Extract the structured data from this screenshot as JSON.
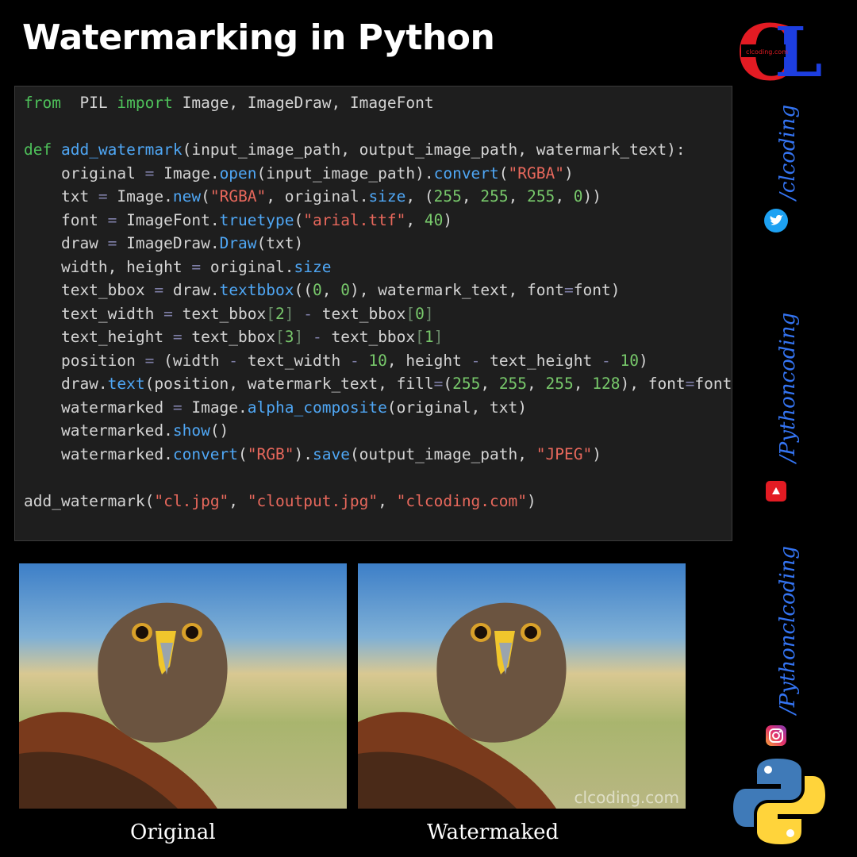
{
  "header": {
    "title": "Watermarking in Python"
  },
  "logo": {
    "letters": "CL",
    "tagline": "clcoding.com"
  },
  "code_lines": [
    [
      [
        "k",
        "from"
      ],
      [
        "",
        "  PIL "
      ],
      [
        "k",
        "import"
      ],
      [
        "",
        " Image, ImageDraw, ImageFont"
      ]
    ],
    [],
    [
      [
        "k",
        "def"
      ],
      [
        "",
        " "
      ],
      [
        "f",
        "add_watermark"
      ],
      [
        "",
        "(input_image_path, output_image_path, watermark_text):"
      ]
    ],
    [
      [
        "",
        "    original "
      ],
      [
        "o",
        "="
      ],
      [
        "",
        " Image."
      ],
      [
        "f",
        "open"
      ],
      [
        "",
        "(input_image_path)."
      ],
      [
        "f",
        "convert"
      ],
      [
        "",
        "("
      ],
      [
        "s",
        "\"RGBA\""
      ],
      [
        "",
        ")"
      ]
    ],
    [
      [
        "",
        "    txt "
      ],
      [
        "o",
        "="
      ],
      [
        "",
        " Image."
      ],
      [
        "f",
        "new"
      ],
      [
        "",
        "("
      ],
      [
        "s",
        "\"RGBA\""
      ],
      [
        "",
        ", original."
      ],
      [
        "f",
        "size"
      ],
      [
        "",
        ", ("
      ],
      [
        "n",
        "255"
      ],
      [
        "",
        ", "
      ],
      [
        "n",
        "255"
      ],
      [
        "",
        ", "
      ],
      [
        "n",
        "255"
      ],
      [
        "",
        ", "
      ],
      [
        "n",
        "0"
      ],
      [
        "",
        "))"
      ]
    ],
    [
      [
        "",
        "    font "
      ],
      [
        "o",
        "="
      ],
      [
        "",
        " ImageFont."
      ],
      [
        "f",
        "truetype"
      ],
      [
        "",
        "("
      ],
      [
        "s",
        "\"arial.ttf\""
      ],
      [
        "",
        ", "
      ],
      [
        "n",
        "40"
      ],
      [
        "",
        ")"
      ]
    ],
    [
      [
        "",
        "    draw "
      ],
      [
        "o",
        "="
      ],
      [
        "",
        " ImageDraw."
      ],
      [
        "f",
        "Draw"
      ],
      [
        "",
        "(txt)"
      ]
    ],
    [
      [
        "",
        "    width, height "
      ],
      [
        "o",
        "="
      ],
      [
        "",
        " original."
      ],
      [
        "f",
        "size"
      ]
    ],
    [
      [
        "",
        "    text_bbox "
      ],
      [
        "o",
        "="
      ],
      [
        "",
        " draw."
      ],
      [
        "f",
        "textbbox"
      ],
      [
        "",
        "(("
      ],
      [
        "n",
        "0"
      ],
      [
        "",
        ", "
      ],
      [
        "n",
        "0"
      ],
      [
        "",
        "), watermark_text, font"
      ],
      [
        "o",
        "="
      ],
      [
        "",
        "font)"
      ]
    ],
    [
      [
        "",
        "    text_width "
      ],
      [
        "o",
        "="
      ],
      [
        "",
        " text_bbox"
      ],
      [
        "b",
        "["
      ],
      [
        "n",
        "2"
      ],
      [
        "b",
        "]"
      ],
      [
        "",
        " "
      ],
      [
        "o",
        "-"
      ],
      [
        "",
        " text_bbox"
      ],
      [
        "b",
        "["
      ],
      [
        "n",
        "0"
      ],
      [
        "b",
        "]"
      ]
    ],
    [
      [
        "",
        "    text_height "
      ],
      [
        "o",
        "="
      ],
      [
        "",
        " text_bbox"
      ],
      [
        "b",
        "["
      ],
      [
        "n",
        "3"
      ],
      [
        "b",
        "]"
      ],
      [
        "",
        " "
      ],
      [
        "o",
        "-"
      ],
      [
        "",
        " text_bbox"
      ],
      [
        "b",
        "["
      ],
      [
        "n",
        "1"
      ],
      [
        "b",
        "]"
      ]
    ],
    [
      [
        "",
        "    position "
      ],
      [
        "o",
        "="
      ],
      [
        "",
        " (width "
      ],
      [
        "o",
        "-"
      ],
      [
        "",
        " text_width "
      ],
      [
        "o",
        "-"
      ],
      [
        "",
        " "
      ],
      [
        "n",
        "10"
      ],
      [
        "",
        ", height "
      ],
      [
        "o",
        "-"
      ],
      [
        "",
        " text_height "
      ],
      [
        "o",
        "-"
      ],
      [
        "",
        " "
      ],
      [
        "n",
        "10"
      ],
      [
        "",
        ")"
      ]
    ],
    [
      [
        "",
        "    draw."
      ],
      [
        "f",
        "text"
      ],
      [
        "",
        "(position, watermark_text, fill"
      ],
      [
        "o",
        "="
      ],
      [
        "",
        "("
      ],
      [
        "n",
        "255"
      ],
      [
        "",
        ", "
      ],
      [
        "n",
        "255"
      ],
      [
        "",
        ", "
      ],
      [
        "n",
        "255"
      ],
      [
        "",
        ", "
      ],
      [
        "n",
        "128"
      ],
      [
        "",
        "), font"
      ],
      [
        "o",
        "="
      ],
      [
        "",
        "font)"
      ]
    ],
    [
      [
        "",
        "    watermarked "
      ],
      [
        "o",
        "="
      ],
      [
        "",
        " Image."
      ],
      [
        "f",
        "alpha_composite"
      ],
      [
        "",
        "(original, txt)"
      ]
    ],
    [
      [
        "",
        "    watermarked."
      ],
      [
        "f",
        "show"
      ],
      [
        "",
        "()"
      ]
    ],
    [
      [
        "",
        "    watermarked."
      ],
      [
        "f",
        "convert"
      ],
      [
        "",
        "("
      ],
      [
        "s",
        "\"RGB\""
      ],
      [
        "",
        ")."
      ],
      [
        "f",
        "save"
      ],
      [
        "",
        "(output_image_path, "
      ],
      [
        "s",
        "\"JPEG\""
      ],
      [
        "",
        ")"
      ]
    ],
    [],
    [
      [
        "",
        "add_watermark("
      ],
      [
        "s",
        "\"cl.jpg\""
      ],
      [
        "",
        ", "
      ],
      [
        "s",
        "\"cloutput.jpg\""
      ],
      [
        "",
        ", "
      ],
      [
        "s",
        "\"clcoding.com\""
      ],
      [
        "",
        ")"
      ]
    ]
  ],
  "images": {
    "original_caption": "Original",
    "watermarked_caption": "Watermaked",
    "watermark_text": "clcoding.com"
  },
  "social": {
    "handles": [
      "/clcoding",
      "/Pythoncoding",
      "/Pythonclcoding"
    ],
    "icons": [
      "twitter-icon",
      "youtube-icon",
      "instagram-icon"
    ]
  },
  "colors": {
    "background": "#000000",
    "code_background": "#1e1e1e",
    "keyword": "#4ec05a",
    "function": "#4fa7f5",
    "string": "#e8685c",
    "number": "#78c96b",
    "handle": "#3474f2",
    "logo_red": "#e31b23",
    "logo_blue": "#1d3ee0"
  }
}
